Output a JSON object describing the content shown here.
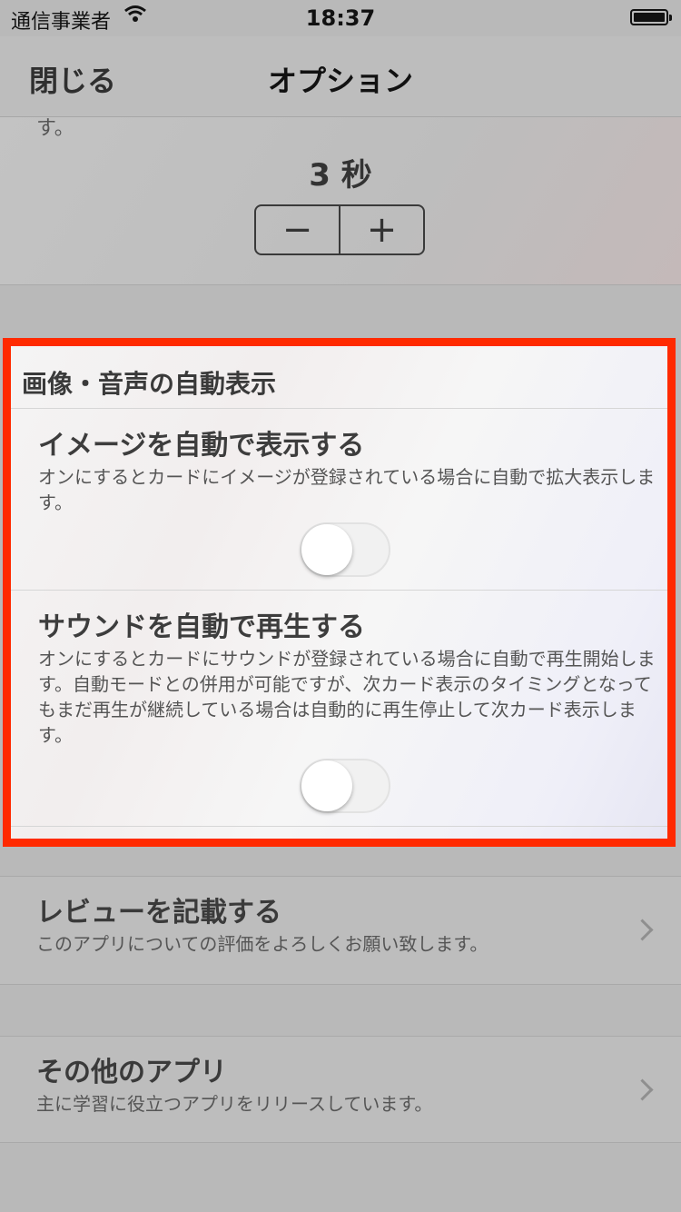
{
  "statusbar": {
    "carrier": "通信事業者",
    "time": "18:37",
    "wifi_icon": "wifi-icon",
    "battery_icon": "battery-icon"
  },
  "navbar": {
    "close_label": "閉じる",
    "title": "オプション"
  },
  "top_section": {
    "cut_text": "す。",
    "seconds_value": "3 秒",
    "stepper_minus": "−",
    "stepper_plus": "+"
  },
  "media_section": {
    "header": "画像・音声の自動表示",
    "options": [
      {
        "title": "イメージを自動で表示する",
        "description": "オンにするとカードにイメージが登録されている場合に自動で拡大表示します。",
        "enabled": false
      },
      {
        "title": "サウンドを自動で再生する",
        "description": "オンにするとカードにサウンドが登録されている場合に自動で再生開始します。自動モードとの併用が可能ですが、次カード表示のタイミングとなってもまだ再生が継続している場合は自動的に再生停止して次カード表示します。",
        "enabled": false
      }
    ]
  },
  "rows": [
    {
      "title": "レビューを記載する",
      "description": "このアプリについての評価をよろしくお願い致します。",
      "icon": "chevron-right-icon"
    },
    {
      "title": "その他のアプリ",
      "description": "主に学習に役立つアプリをリリースしています。",
      "icon": "chevron-right-icon"
    }
  ],
  "colors": {
    "highlight_border": "#ff2a00",
    "dim_background": "#b9b9b9"
  }
}
